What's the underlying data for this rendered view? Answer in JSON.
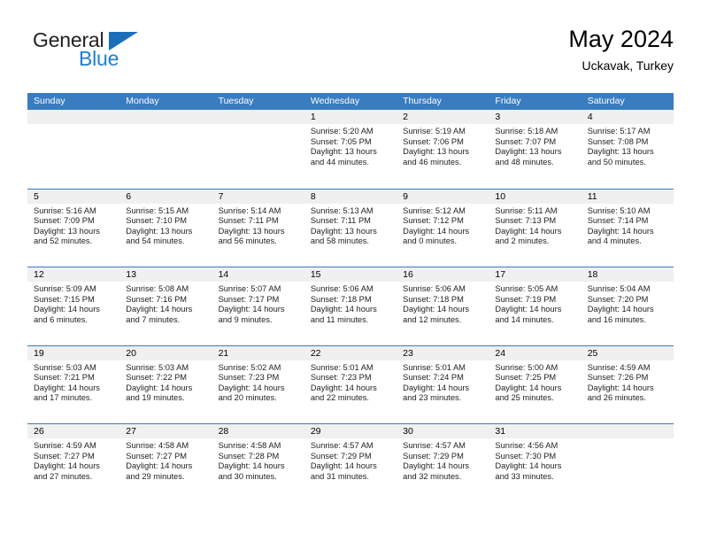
{
  "brand": {
    "name_part1": "General",
    "name_part2": "Blue",
    "accent_color": "#1a6fba"
  },
  "header": {
    "title": "May 2024",
    "subtitle": "Uckavak, Turkey"
  },
  "calendar": {
    "header_color": "#3a7cc0",
    "weekdays": [
      "Sunday",
      "Monday",
      "Tuesday",
      "Wednesday",
      "Thursday",
      "Friday",
      "Saturday"
    ],
    "weeks": [
      [
        {
          "day": "",
          "sunrise": "",
          "sunset": "",
          "daylight_line1": "",
          "daylight_line2": "",
          "empty": true
        },
        {
          "day": "",
          "sunrise": "",
          "sunset": "",
          "daylight_line1": "",
          "daylight_line2": "",
          "empty": true
        },
        {
          "day": "",
          "sunrise": "",
          "sunset": "",
          "daylight_line1": "",
          "daylight_line2": "",
          "empty": true
        },
        {
          "day": "1",
          "sunrise": "Sunrise: 5:20 AM",
          "sunset": "Sunset: 7:05 PM",
          "daylight_line1": "Daylight: 13 hours",
          "daylight_line2": "and 44 minutes.",
          "empty": false
        },
        {
          "day": "2",
          "sunrise": "Sunrise: 5:19 AM",
          "sunset": "Sunset: 7:06 PM",
          "daylight_line1": "Daylight: 13 hours",
          "daylight_line2": "and 46 minutes.",
          "empty": false
        },
        {
          "day": "3",
          "sunrise": "Sunrise: 5:18 AM",
          "sunset": "Sunset: 7:07 PM",
          "daylight_line1": "Daylight: 13 hours",
          "daylight_line2": "and 48 minutes.",
          "empty": false
        },
        {
          "day": "4",
          "sunrise": "Sunrise: 5:17 AM",
          "sunset": "Sunset: 7:08 PM",
          "daylight_line1": "Daylight: 13 hours",
          "daylight_line2": "and 50 minutes.",
          "empty": false
        }
      ],
      [
        {
          "day": "5",
          "sunrise": "Sunrise: 5:16 AM",
          "sunset": "Sunset: 7:09 PM",
          "daylight_line1": "Daylight: 13 hours",
          "daylight_line2": "and 52 minutes.",
          "empty": false
        },
        {
          "day": "6",
          "sunrise": "Sunrise: 5:15 AM",
          "sunset": "Sunset: 7:10 PM",
          "daylight_line1": "Daylight: 13 hours",
          "daylight_line2": "and 54 minutes.",
          "empty": false
        },
        {
          "day": "7",
          "sunrise": "Sunrise: 5:14 AM",
          "sunset": "Sunset: 7:11 PM",
          "daylight_line1": "Daylight: 13 hours",
          "daylight_line2": "and 56 minutes.",
          "empty": false
        },
        {
          "day": "8",
          "sunrise": "Sunrise: 5:13 AM",
          "sunset": "Sunset: 7:11 PM",
          "daylight_line1": "Daylight: 13 hours",
          "daylight_line2": "and 58 minutes.",
          "empty": false
        },
        {
          "day": "9",
          "sunrise": "Sunrise: 5:12 AM",
          "sunset": "Sunset: 7:12 PM",
          "daylight_line1": "Daylight: 14 hours",
          "daylight_line2": "and 0 minutes.",
          "empty": false
        },
        {
          "day": "10",
          "sunrise": "Sunrise: 5:11 AM",
          "sunset": "Sunset: 7:13 PM",
          "daylight_line1": "Daylight: 14 hours",
          "daylight_line2": "and 2 minutes.",
          "empty": false
        },
        {
          "day": "11",
          "sunrise": "Sunrise: 5:10 AM",
          "sunset": "Sunset: 7:14 PM",
          "daylight_line1": "Daylight: 14 hours",
          "daylight_line2": "and 4 minutes.",
          "empty": false
        }
      ],
      [
        {
          "day": "12",
          "sunrise": "Sunrise: 5:09 AM",
          "sunset": "Sunset: 7:15 PM",
          "daylight_line1": "Daylight: 14 hours",
          "daylight_line2": "and 6 minutes.",
          "empty": false
        },
        {
          "day": "13",
          "sunrise": "Sunrise: 5:08 AM",
          "sunset": "Sunset: 7:16 PM",
          "daylight_line1": "Daylight: 14 hours",
          "daylight_line2": "and 7 minutes.",
          "empty": false
        },
        {
          "day": "14",
          "sunrise": "Sunrise: 5:07 AM",
          "sunset": "Sunset: 7:17 PM",
          "daylight_line1": "Daylight: 14 hours",
          "daylight_line2": "and 9 minutes.",
          "empty": false
        },
        {
          "day": "15",
          "sunrise": "Sunrise: 5:06 AM",
          "sunset": "Sunset: 7:18 PM",
          "daylight_line1": "Daylight: 14 hours",
          "daylight_line2": "and 11 minutes.",
          "empty": false
        },
        {
          "day": "16",
          "sunrise": "Sunrise: 5:06 AM",
          "sunset": "Sunset: 7:18 PM",
          "daylight_line1": "Daylight: 14 hours",
          "daylight_line2": "and 12 minutes.",
          "empty": false
        },
        {
          "day": "17",
          "sunrise": "Sunrise: 5:05 AM",
          "sunset": "Sunset: 7:19 PM",
          "daylight_line1": "Daylight: 14 hours",
          "daylight_line2": "and 14 minutes.",
          "empty": false
        },
        {
          "day": "18",
          "sunrise": "Sunrise: 5:04 AM",
          "sunset": "Sunset: 7:20 PM",
          "daylight_line1": "Daylight: 14 hours",
          "daylight_line2": "and 16 minutes.",
          "empty": false
        }
      ],
      [
        {
          "day": "19",
          "sunrise": "Sunrise: 5:03 AM",
          "sunset": "Sunset: 7:21 PM",
          "daylight_line1": "Daylight: 14 hours",
          "daylight_line2": "and 17 minutes.",
          "empty": false
        },
        {
          "day": "20",
          "sunrise": "Sunrise: 5:03 AM",
          "sunset": "Sunset: 7:22 PM",
          "daylight_line1": "Daylight: 14 hours",
          "daylight_line2": "and 19 minutes.",
          "empty": false
        },
        {
          "day": "21",
          "sunrise": "Sunrise: 5:02 AM",
          "sunset": "Sunset: 7:23 PM",
          "daylight_line1": "Daylight: 14 hours",
          "daylight_line2": "and 20 minutes.",
          "empty": false
        },
        {
          "day": "22",
          "sunrise": "Sunrise: 5:01 AM",
          "sunset": "Sunset: 7:23 PM",
          "daylight_line1": "Daylight: 14 hours",
          "daylight_line2": "and 22 minutes.",
          "empty": false
        },
        {
          "day": "23",
          "sunrise": "Sunrise: 5:01 AM",
          "sunset": "Sunset: 7:24 PM",
          "daylight_line1": "Daylight: 14 hours",
          "daylight_line2": "and 23 minutes.",
          "empty": false
        },
        {
          "day": "24",
          "sunrise": "Sunrise: 5:00 AM",
          "sunset": "Sunset: 7:25 PM",
          "daylight_line1": "Daylight: 14 hours",
          "daylight_line2": "and 25 minutes.",
          "empty": false
        },
        {
          "day": "25",
          "sunrise": "Sunrise: 4:59 AM",
          "sunset": "Sunset: 7:26 PM",
          "daylight_line1": "Daylight: 14 hours",
          "daylight_line2": "and 26 minutes.",
          "empty": false
        }
      ],
      [
        {
          "day": "26",
          "sunrise": "Sunrise: 4:59 AM",
          "sunset": "Sunset: 7:27 PM",
          "daylight_line1": "Daylight: 14 hours",
          "daylight_line2": "and 27 minutes.",
          "empty": false
        },
        {
          "day": "27",
          "sunrise": "Sunrise: 4:58 AM",
          "sunset": "Sunset: 7:27 PM",
          "daylight_line1": "Daylight: 14 hours",
          "daylight_line2": "and 29 minutes.",
          "empty": false
        },
        {
          "day": "28",
          "sunrise": "Sunrise: 4:58 AM",
          "sunset": "Sunset: 7:28 PM",
          "daylight_line1": "Daylight: 14 hours",
          "daylight_line2": "and 30 minutes.",
          "empty": false
        },
        {
          "day": "29",
          "sunrise": "Sunrise: 4:57 AM",
          "sunset": "Sunset: 7:29 PM",
          "daylight_line1": "Daylight: 14 hours",
          "daylight_line2": "and 31 minutes.",
          "empty": false
        },
        {
          "day": "30",
          "sunrise": "Sunrise: 4:57 AM",
          "sunset": "Sunset: 7:29 PM",
          "daylight_line1": "Daylight: 14 hours",
          "daylight_line2": "and 32 minutes.",
          "empty": false
        },
        {
          "day": "31",
          "sunrise": "Sunrise: 4:56 AM",
          "sunset": "Sunset: 7:30 PM",
          "daylight_line1": "Daylight: 14 hours",
          "daylight_line2": "and 33 minutes.",
          "empty": false
        },
        {
          "day": "",
          "sunrise": "",
          "sunset": "",
          "daylight_line1": "",
          "daylight_line2": "",
          "empty": true
        }
      ]
    ]
  }
}
